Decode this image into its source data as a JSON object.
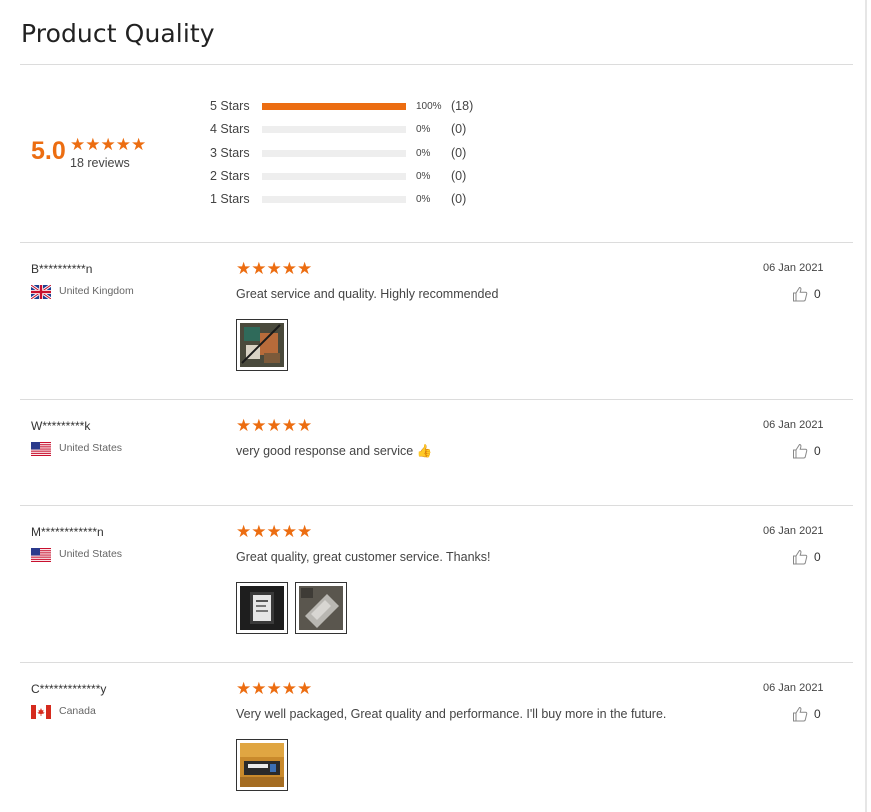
{
  "section_title": "Product Quality",
  "summary": {
    "average": "5.0",
    "stars": "★★★★★",
    "review_count": "18 reviews",
    "distribution": [
      {
        "label": "5 Stars",
        "fill": 1.0,
        "percent": "100%",
        "count": "(18)"
      },
      {
        "label": "4 Stars",
        "fill": 0.0,
        "percent": "0%",
        "count": "(0)"
      },
      {
        "label": "3 Stars",
        "fill": 0.0,
        "percent": "0%",
        "count": "(0)"
      },
      {
        "label": "2 Stars",
        "fill": 0.0,
        "percent": "0%",
        "count": "(0)"
      },
      {
        "label": "1 Stars",
        "fill": 0.0,
        "percent": "0%",
        "count": "(0)"
      }
    ]
  },
  "reviews": [
    {
      "reviewer": "B**********n",
      "country": "United Kingdom",
      "flag_icon": "uk-flag-icon",
      "stars": "★★★★★",
      "rating": 5,
      "comment": "Great service and quality. Highly recommended",
      "date": "06 Jan 2021",
      "likes": "0",
      "photo_count": 1
    },
    {
      "reviewer": "W*********k",
      "country": "United States",
      "flag_icon": "us-flag-icon",
      "stars": "★★★★★",
      "rating": 5,
      "comment": "very good response and service 👍",
      "date": "06 Jan 2021",
      "likes": "0",
      "photo_count": 0
    },
    {
      "reviewer": "M************n",
      "country": "United States",
      "flag_icon": "us-flag-icon",
      "stars": "★★★★★",
      "rating": 5,
      "comment": "Great quality, great customer service. Thanks!",
      "date": "06 Jan 2021",
      "likes": "0",
      "photo_count": 2
    },
    {
      "reviewer": "C*************y",
      "country": "Canada",
      "flag_icon": "canada-flag-icon",
      "stars": "★★★★★",
      "rating": 5,
      "comment": "Very well packaged, Great quality and performance. I'll buy more in the future.",
      "date": "06 Jan 2021",
      "likes": "0",
      "photo_count": 1
    }
  ],
  "colors": {
    "accent": "#ec6d11",
    "track": "#eeeeee",
    "divider": "#dcdcdc"
  }
}
